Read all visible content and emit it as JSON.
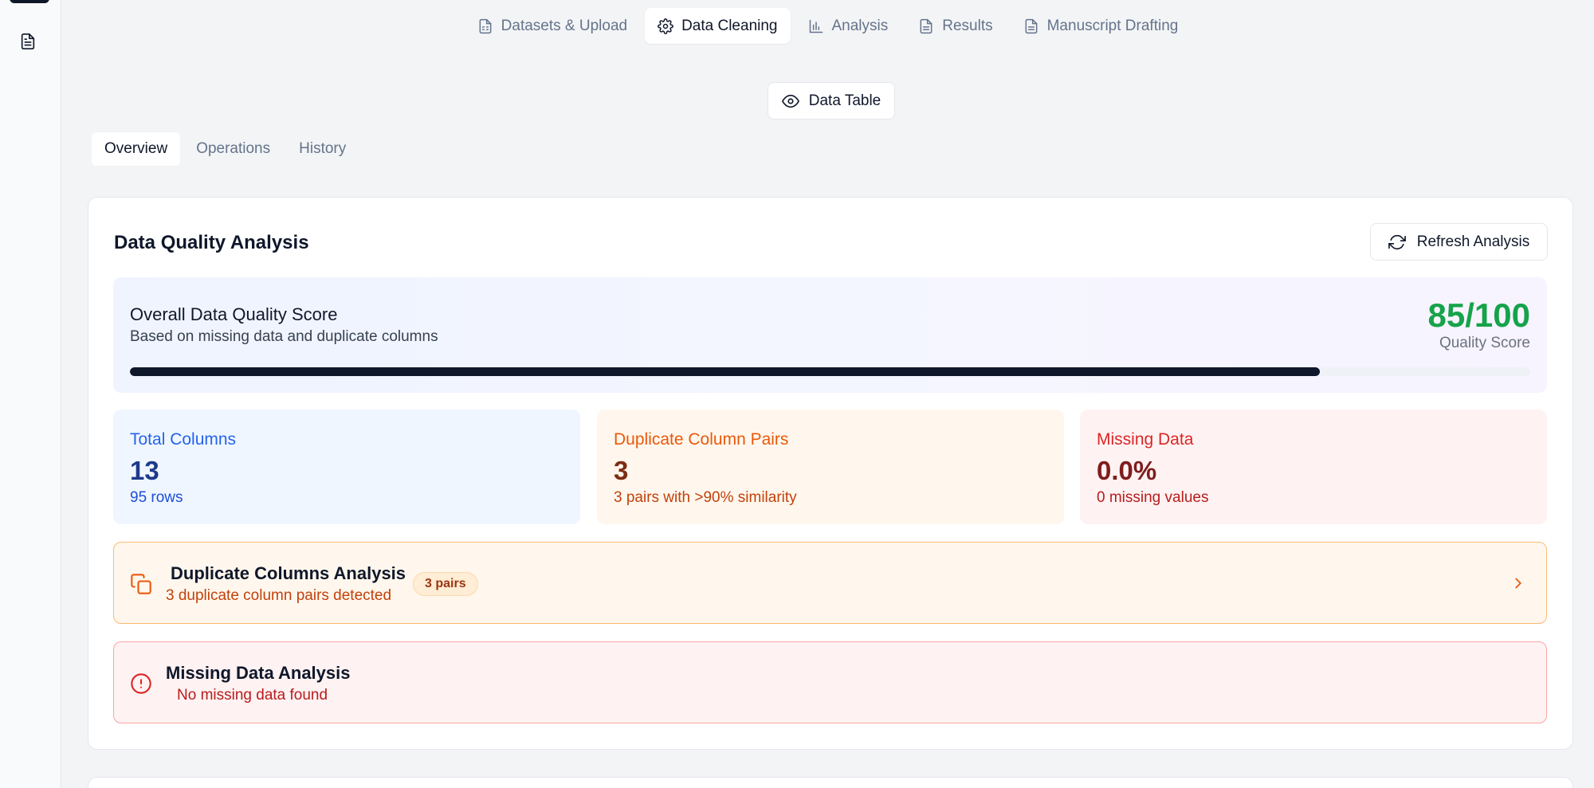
{
  "nav": {
    "tabs": [
      {
        "label": "Datasets & Upload",
        "icon": "file-spreadsheet-icon"
      },
      {
        "label": "Data Cleaning",
        "icon": "gear-icon",
        "active": true
      },
      {
        "label": "Analysis",
        "icon": "bar-chart-icon"
      },
      {
        "label": "Results",
        "icon": "file-text-icon"
      },
      {
        "label": "Manuscript Drafting",
        "icon": "file-text-icon"
      }
    ]
  },
  "toolbar": {
    "data_table_label": "Data Table"
  },
  "subtabs": [
    {
      "label": "Overview",
      "active": true
    },
    {
      "label": "Operations"
    },
    {
      "label": "History"
    }
  ],
  "card": {
    "title": "Data Quality Analysis",
    "refresh_label": "Refresh Analysis"
  },
  "quality": {
    "title": "Overall Data Quality Score",
    "subtitle": "Based on missing data and duplicate columns",
    "score_text": "85/100",
    "score_label": "Quality Score",
    "progress_percent": 85
  },
  "stats": {
    "total_columns": {
      "label": "Total Columns",
      "value": "13",
      "sub": "95 rows"
    },
    "duplicate_pairs": {
      "label": "Duplicate Column Pairs",
      "value": "3",
      "sub": "3 pairs with >90% similarity"
    },
    "missing_data": {
      "label": "Missing Data",
      "value": "0.0%",
      "sub": "0 missing values"
    }
  },
  "duplicates": {
    "title": "Duplicate Columns Analysis",
    "subtitle": "3 duplicate column pairs detected",
    "badge": "3 pairs"
  },
  "missing": {
    "title": "Missing Data Analysis",
    "subtitle": "No missing data found"
  },
  "colors": {
    "accent_dark": "#0f172a",
    "score_green": "#16a34a",
    "blue": "#2563eb",
    "orange": "#ea580c",
    "red": "#dc2626"
  }
}
